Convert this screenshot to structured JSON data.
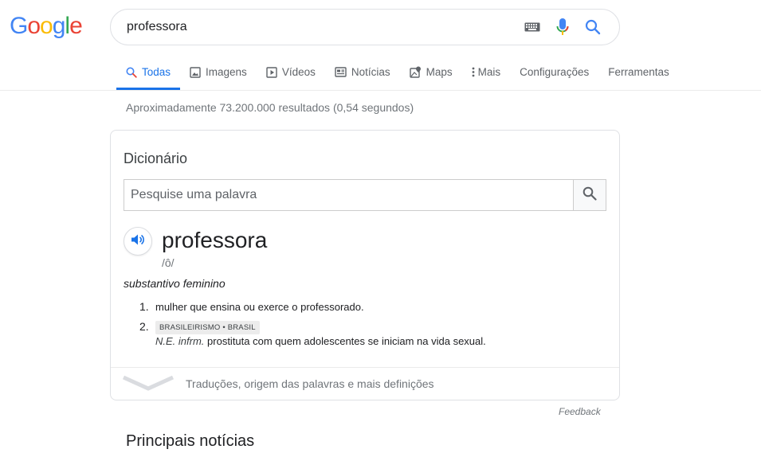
{
  "logo": [
    "G",
    "o",
    "o",
    "g",
    "l",
    "e"
  ],
  "logo_colors": [
    "#4285f4",
    "#ea4335",
    "#fbbc05",
    "#4285f4",
    "#34a853",
    "#ea4335"
  ],
  "search": {
    "query": "professora"
  },
  "tabs": [
    {
      "label": "Todas",
      "icon": "search-icon"
    },
    {
      "label": "Imagens",
      "icon": "image-icon"
    },
    {
      "label": "Vídeos",
      "icon": "play-icon"
    },
    {
      "label": "Notícias",
      "icon": "news-icon"
    },
    {
      "label": "Maps",
      "icon": "map-icon"
    },
    {
      "label": "Mais",
      "icon": "more-vert-icon"
    },
    {
      "label": "Configurações"
    },
    {
      "label": "Ferramentas"
    }
  ],
  "stats": "Aproximadamente 73.200.000 resultados (0,54 segundos)",
  "dictionary": {
    "title": "Dicionário",
    "placeholder": "Pesquise uma palavra",
    "word": "professora",
    "pronunciation": "/ô/",
    "part_of_speech": "substantivo feminino",
    "definitions": [
      {
        "num": "1.",
        "text": "mulher que ensina ou exerce o professorado."
      },
      {
        "num": "2.",
        "tag": "BRASILEIRISMO • BRASIL",
        "qualifier": "N.E. infrm.",
        "text": "prostituta com quem adolescentes se iniciam na vida sexual."
      }
    ],
    "more_link": "Traduções, origem das palavras e mais definições"
  },
  "feedback": "Feedback",
  "section_title": "Principais notícias",
  "colors": {
    "accent": "#1a73e8",
    "muted": "#70757a"
  }
}
